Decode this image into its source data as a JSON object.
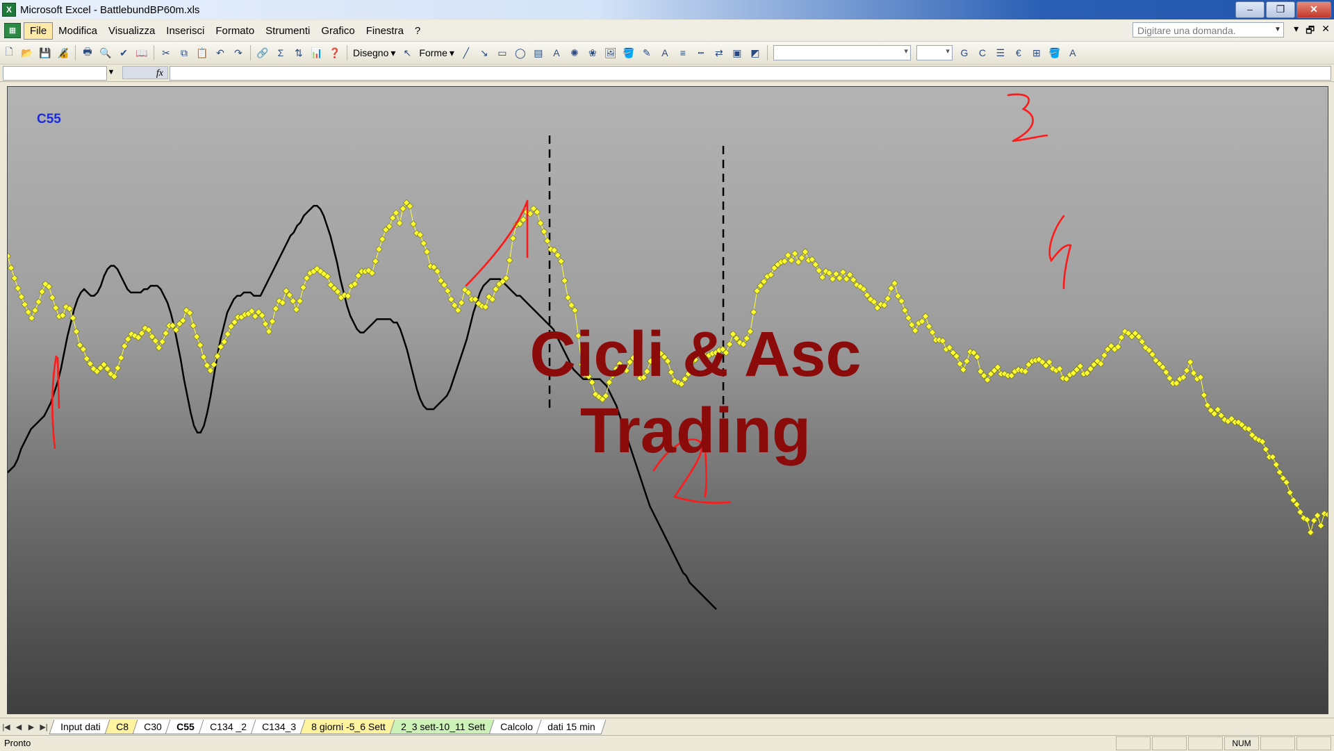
{
  "window": {
    "app_title": "Microsoft Excel - BattlebundBP60m.xls",
    "controls": [
      "–",
      "❐",
      "✕"
    ]
  },
  "menu": {
    "items": [
      "File",
      "Modifica",
      "Visualizza",
      "Inserisci",
      "Formato",
      "Strumenti",
      "Grafico",
      "Finestra",
      "?"
    ],
    "ask_placeholder": "Digitare una domanda.",
    "right_controls": [
      "▾",
      "🗗",
      "✕"
    ]
  },
  "toolbar": {
    "drawing_label": "Disegno",
    "shapes_label": "Forme",
    "bold": "G",
    "italic": "C",
    "euro": "€"
  },
  "formula_bar": {
    "fx": "fx"
  },
  "chart": {
    "name": "C55",
    "watermark_line1": "Cicli & Asc",
    "watermark_line2": "Trading",
    "annotations": [
      "1",
      "2",
      "3",
      "4"
    ],
    "colors": {
      "price_points": "#ffff33",
      "cycle_line": "#000000",
      "annotation": "#ff1a1a",
      "watermark": "#8b0b0b"
    }
  },
  "chart_data": {
    "type": "line",
    "series": [
      {
        "points": [
          538,
          524,
          512,
          500,
          490,
          481,
          472,
          465,
          474,
          484,
          496,
          505,
          502,
          489,
          477,
          467,
          468,
          478,
          476,
          465,
          449,
          433,
          428,
          417,
          411,
          405,
          402,
          406,
          410,
          405,
          399,
          396,
          406,
          418,
          432,
          440,
          446,
          444,
          442,
          447,
          453,
          451,
          443,
          438,
          430,
          437,
          447,
          456,
          456,
          451,
          458,
          462,
          474,
          471,
          456,
          443,
          433,
          419,
          409,
          403,
          410,
          420,
          431,
          437,
          446,
          455,
          460,
          466,
          466,
          469,
          470,
          473,
          467,
          472,
          468,
          458,
          449,
          461,
          476,
          485,
          483,
          497,
          492,
          485,
          475,
          485,
          501,
          512,
          518,
          520,
          523,
          520,
          517,
          514,
          504,
          500,
          496,
          489,
          492,
          491,
          503,
          505,
          515,
          520,
          520,
          521,
          518,
          532,
          546,
          558,
          569,
          573,
          583,
          589,
          577,
          594,
          601,
          597,
          576,
          565,
          563,
          553,
          543,
          526,
          525,
          520,
          509,
          504,
          497,
          487,
          480,
          474,
          483,
          498,
          495,
          487,
          487,
          482,
          479,
          478,
          490,
          487,
          499,
          505,
          508,
          512,
          533,
          559,
          575,
          576,
          581,
          590,
          588,
          594,
          590,
          577,
          567,
          556,
          546,
          545,
          539,
          532,
          509,
          489,
          480,
          474,
          444,
          410,
          398,
          396,
          389,
          375,
          372,
          369,
          373,
          389,
          397,
          405,
          411,
          404,
          403,
          413,
          418,
          409,
          394,
          395,
          402,
          414,
          419,
          420,
          423,
          419,
          414,
          401,
          391,
          389,
          387,
          393,
          399,
          413,
          416,
          422,
          424,
          420,
          421,
          423,
          424,
          427,
          428,
          424,
          434,
          446,
          441,
          436,
          434,
          441,
          449,
          472,
          497,
          503,
          508,
          514,
          516,
          524,
          528,
          531,
          532,
          539,
          533,
          541,
          531,
          536,
          543,
          533,
          534,
          528,
          521,
          513,
          520,
          518,
          511,
          517,
          512,
          519,
          511,
          516,
          510,
          504,
          502,
          499,
          492,
          487,
          484,
          477,
          481,
          480,
          488,
          500,
          506,
          491,
          485,
          474,
          465,
          457,
          450,
          459,
          461,
          467,
          455,
          448,
          439,
          439,
          438,
          428,
          430,
          424,
          420,
          411,
          404,
          414,
          425,
          424,
          419,
          402,
          397,
          392,
          399,
          403,
          407,
          399,
          399,
          397,
          397,
          402,
          404,
          403,
          402,
          410,
          414,
          415,
          416,
          413,
          409,
          413,
          405,
          403,
          405,
          394,
          393,
          398,
          400,
          404,
          408,
          399,
          400,
          405,
          410,
          414,
          411,
          421,
          428,
          432,
          428,
          431,
          442,
          449,
          447,
          443,
          447,
          443,
          437,
          430,
          427,
          422,
          415,
          411,
          407,
          401,
          394,
          388,
          388,
          393,
          395,
          403,
          413,
          400,
          393,
          395,
          374,
          362,
          356,
          352,
          357,
          350,
          345,
          343,
          346,
          342,
          342,
          339,
          335,
          334,
          327,
          323,
          321,
          319,
          310,
          301,
          301,
          292,
          283,
          276,
          271,
          259,
          250,
          245,
          236,
          229,
          227,
          212,
          226,
          232,
          220,
          234,
          233,
          224,
          216,
          229,
          234,
          259,
          271,
          289,
          283,
          286,
          292,
          301,
          298,
          295,
          284,
          292,
          285,
          278,
          259,
          281,
          293,
          301,
          275,
          257
        ]
      },
      {
        "points": [
          0.49,
          0.48,
          0.47,
          0.45,
          0.42,
          0.4,
          0.38,
          0.36,
          0.35,
          0.34,
          0.33,
          0.32,
          0.3,
          0.28,
          0.25,
          0.22,
          0.18,
          0.13,
          0.08,
          0.04,
          0.0,
          -0.03,
          -0.05,
          -0.06,
          -0.05,
          -0.04,
          -0.04,
          -0.05,
          -0.07,
          -0.1,
          -0.12,
          -0.13,
          -0.13,
          -0.12,
          -0.1,
          -0.08,
          -0.06,
          -0.05,
          -0.05,
          -0.05,
          -0.05,
          -0.06,
          -0.06,
          -0.07,
          -0.07,
          -0.07,
          -0.06,
          -0.04,
          -0.02,
          0.01,
          0.05,
          0.1,
          0.15,
          0.21,
          0.26,
          0.31,
          0.35,
          0.37,
          0.37,
          0.35,
          0.31,
          0.26,
          0.2,
          0.14,
          0.09,
          0.05,
          0.01,
          -0.01,
          -0.03,
          -0.04,
          -0.04,
          -0.05,
          -0.05,
          -0.05,
          -0.04,
          -0.04,
          -0.04,
          -0.06,
          -0.08,
          -0.1,
          -0.12,
          -0.14,
          -0.16,
          -0.18,
          -0.2,
          -0.22,
          -0.23,
          -0.25,
          -0.26,
          -0.28,
          -0.29,
          -0.3,
          -0.31,
          -0.31,
          -0.3,
          -0.28,
          -0.25,
          -0.22,
          -0.18,
          -0.14,
          -0.09,
          -0.05,
          -0.01,
          0.02,
          0.04,
          0.06,
          0.07,
          0.07,
          0.06,
          0.05,
          0.04,
          0.03,
          0.03,
          0.03,
          0.03,
          0.03,
          0.04,
          0.04,
          0.06,
          0.09,
          0.12,
          0.16,
          0.2,
          0.24,
          0.27,
          0.29,
          0.3,
          0.3,
          0.3,
          0.29,
          0.28,
          0.27,
          0.26,
          0.24,
          0.21,
          0.18,
          0.15,
          0.12,
          0.09,
          0.05,
          0.01,
          -0.02,
          -0.05,
          -0.07,
          -0.08,
          -0.09,
          -0.09,
          -0.09,
          -0.09,
          -0.08,
          -0.07,
          -0.06,
          -0.05,
          -0.04,
          -0.04,
          -0.03,
          -0.02,
          -0.01,
          0.0,
          0.01,
          0.02,
          0.03,
          0.04,
          0.05,
          0.06,
          0.08,
          0.1,
          0.12,
          0.14,
          0.16,
          0.18,
          0.19,
          0.2,
          0.21,
          0.21,
          0.21,
          0.21,
          0.21,
          0.21,
          0.22,
          0.23,
          0.25,
          0.27,
          0.29,
          0.32,
          0.35,
          0.38,
          0.41,
          0.44,
          0.47,
          0.5,
          0.53,
          0.56,
          0.59,
          0.61,
          0.63,
          0.65,
          0.67,
          0.69,
          0.71,
          0.73,
          0.75,
          0.77,
          0.79,
          0.8,
          0.82,
          0.83,
          0.84,
          0.85,
          0.86,
          0.87,
          0.88,
          0.89,
          0.9
        ]
      }
    ],
    "xlim": [
      0,
      384
    ]
  }
}
